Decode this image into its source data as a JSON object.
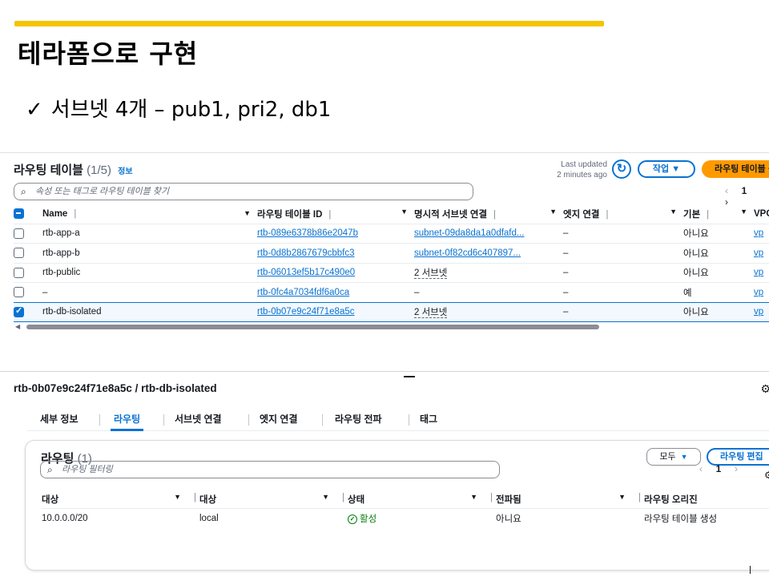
{
  "slide": {
    "title": "테라폼으로 구현",
    "bullet_check": "✓",
    "bullet_text": "서브넷 4개 – pub1, pri2, db1"
  },
  "colors": {
    "accent_bar": "#f5c400",
    "aws_blue": "#0972d3",
    "aws_orange": "#ff9900",
    "status_green": "#037f0c"
  },
  "route_tables": {
    "title": "라우팅 테이블",
    "count": "(1/5)",
    "info_link": "정보",
    "last_updated_label": "Last updated",
    "last_updated_value": "2 minutes ago",
    "actions_label": "작업",
    "create_label": "라우팅 테이블 생성",
    "search_placeholder": "속성 또는 태그로 라우팅 테이블 찾기",
    "pager": {
      "prev": "‹",
      "page": "1",
      "next": "›"
    },
    "columns": [
      "Name",
      "라우팅 테이블 ID",
      "명시적 서브넷 연결",
      "엣지 연결",
      "기본",
      "VPC"
    ],
    "rows": [
      {
        "name": "rtb-app-a",
        "id": "rtb-089e6378b86e2047b",
        "subnet": "subnet-09da8da1a0dfafd...",
        "edge": "–",
        "main": "아니요",
        "vpc": "vp",
        "checked": false
      },
      {
        "name": "rtb-app-b",
        "id": "rtb-0d8b2867679cbbfc3",
        "subnet": "subnet-0f82cd6c407897...",
        "edge": "–",
        "main": "아니요",
        "vpc": "vp",
        "checked": false
      },
      {
        "name": "rtb-public",
        "id": "rtb-06013ef5b17c490e0",
        "subnet": "2 서브넷",
        "edge": "–",
        "main": "아니요",
        "vpc": "vp",
        "checked": false
      },
      {
        "name": "–",
        "id": "rtb-0fc4a7034fdf6a0ca",
        "subnet": "–",
        "edge": "–",
        "main": "예",
        "vpc": "vp",
        "checked": false
      },
      {
        "name": "rtb-db-isolated",
        "id": "rtb-0b07e9c24f71e8a5c",
        "subnet": "2 서브넷",
        "edge": "–",
        "main": "아니요",
        "vpc": "vp",
        "checked": true
      }
    ]
  },
  "detail": {
    "title": "rtb-0b07e9c24f71e8a5c / rtb-db-isolated",
    "tabs": [
      "세부 정보",
      "라우팅",
      "서브넷 연결",
      "엣지 연결",
      "라우팅 전파",
      "태그"
    ],
    "active_tab": "라우팅",
    "routes_card": {
      "title": "라우팅",
      "count": "(1)",
      "filter_label": "모두",
      "edit_label": "라우팅 편집",
      "search_placeholder": "라우팅 필터링",
      "pager": {
        "prev": "‹",
        "page": "1",
        "next": "›"
      },
      "columns": [
        "대상",
        "대상",
        "상태",
        "전파됨",
        "라우팅 오리진"
      ],
      "rows": [
        {
          "destination": "10.0.0.0/20",
          "target": "local",
          "status": "활성",
          "propagated": "아니요",
          "origin": "라우팅 테이블 생성"
        }
      ]
    }
  }
}
